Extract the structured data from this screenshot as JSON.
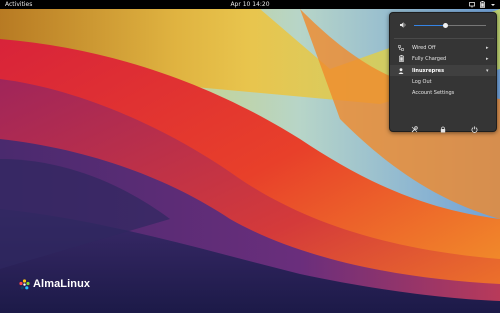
{
  "topbar": {
    "activities_label": "Activities",
    "clock": "Apr 10  14:20",
    "icons": [
      "network-icon",
      "battery-icon",
      "chevron-down-icon"
    ]
  },
  "system_menu": {
    "volume": {
      "icon": "speaker-icon",
      "level": 0.44
    },
    "network": {
      "icon": "network-wired-icon",
      "label": "Wired Off"
    },
    "power": {
      "icon": "battery-icon",
      "label": "Fully Charged"
    },
    "user": {
      "icon": "user-icon",
      "name": "linuxrepres",
      "submenu": [
        "Log Out",
        "Account Settings"
      ]
    },
    "actions": [
      "settings-icon",
      "lock-icon",
      "power-off-icon"
    ]
  },
  "desktop": {
    "brand": "AlmaLinux"
  }
}
